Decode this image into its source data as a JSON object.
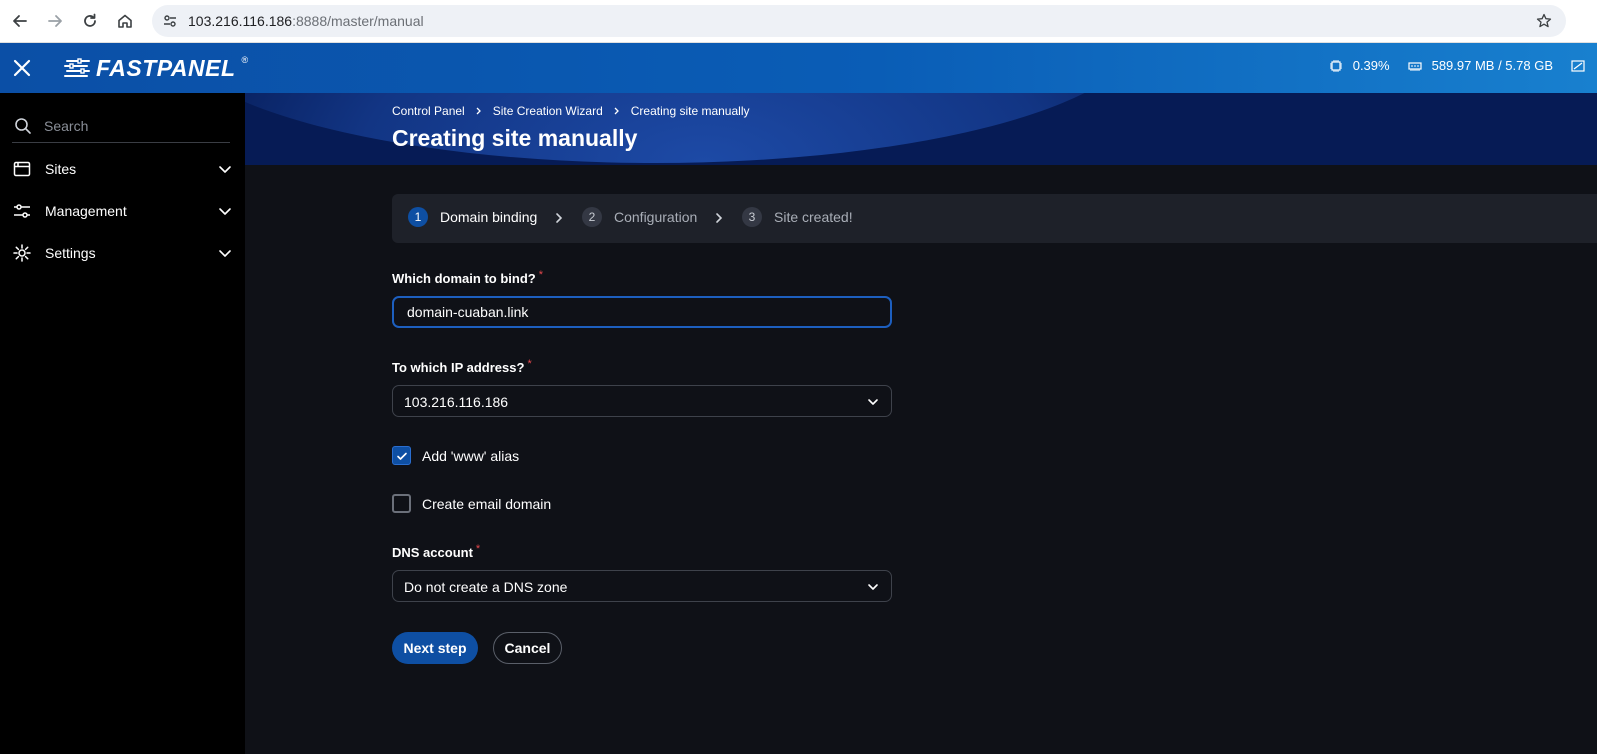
{
  "browser": {
    "address_host": "103.216.116.186",
    "address_rest": ":8888/master/manual"
  },
  "header": {
    "logo_text": "FASTPANEL",
    "logo_reg": "®",
    "cpu_usage": "0.39%",
    "memory_usage": "589.97 MB / 5.78 GB"
  },
  "sidebar": {
    "search_placeholder": "Search",
    "items": [
      {
        "label": "Sites",
        "icon": "browser-window-icon"
      },
      {
        "label": "Management",
        "icon": "sliders-icon"
      },
      {
        "label": "Settings",
        "icon": "gear-icon"
      }
    ]
  },
  "breadcrumb": [
    "Control Panel",
    "Site Creation Wizard",
    "Creating site manually"
  ],
  "page_title": "Creating site manually",
  "steps": [
    {
      "num": "1",
      "label": "Domain binding",
      "state": "active"
    },
    {
      "num": "2",
      "label": "Configuration",
      "state": "inactive"
    },
    {
      "num": "3",
      "label": "Site created!",
      "state": "inactive"
    }
  ],
  "form": {
    "domain_label": "Which domain to bind?",
    "domain_value": "domain-cuaban.link",
    "ip_label": "To which IP address?",
    "ip_value": "103.216.116.186",
    "www_alias_label": "Add 'www' alias",
    "www_alias_checked": true,
    "email_domain_label": "Create email domain",
    "email_domain_checked": false,
    "dns_label": "DNS account",
    "dns_value": "Do not create a DNS zone",
    "required_mark": "*",
    "next_button": "Next step",
    "cancel_button": "Cancel"
  },
  "colors": {
    "accent": "#0e4fa3",
    "header_gradient_start": "#0b4fa6",
    "header_gradient_end": "#1880cf",
    "hero_bg": "#061b55",
    "page_bg": "#0f1117",
    "sidebar_bg": "#000000",
    "required": "#e5484d"
  }
}
